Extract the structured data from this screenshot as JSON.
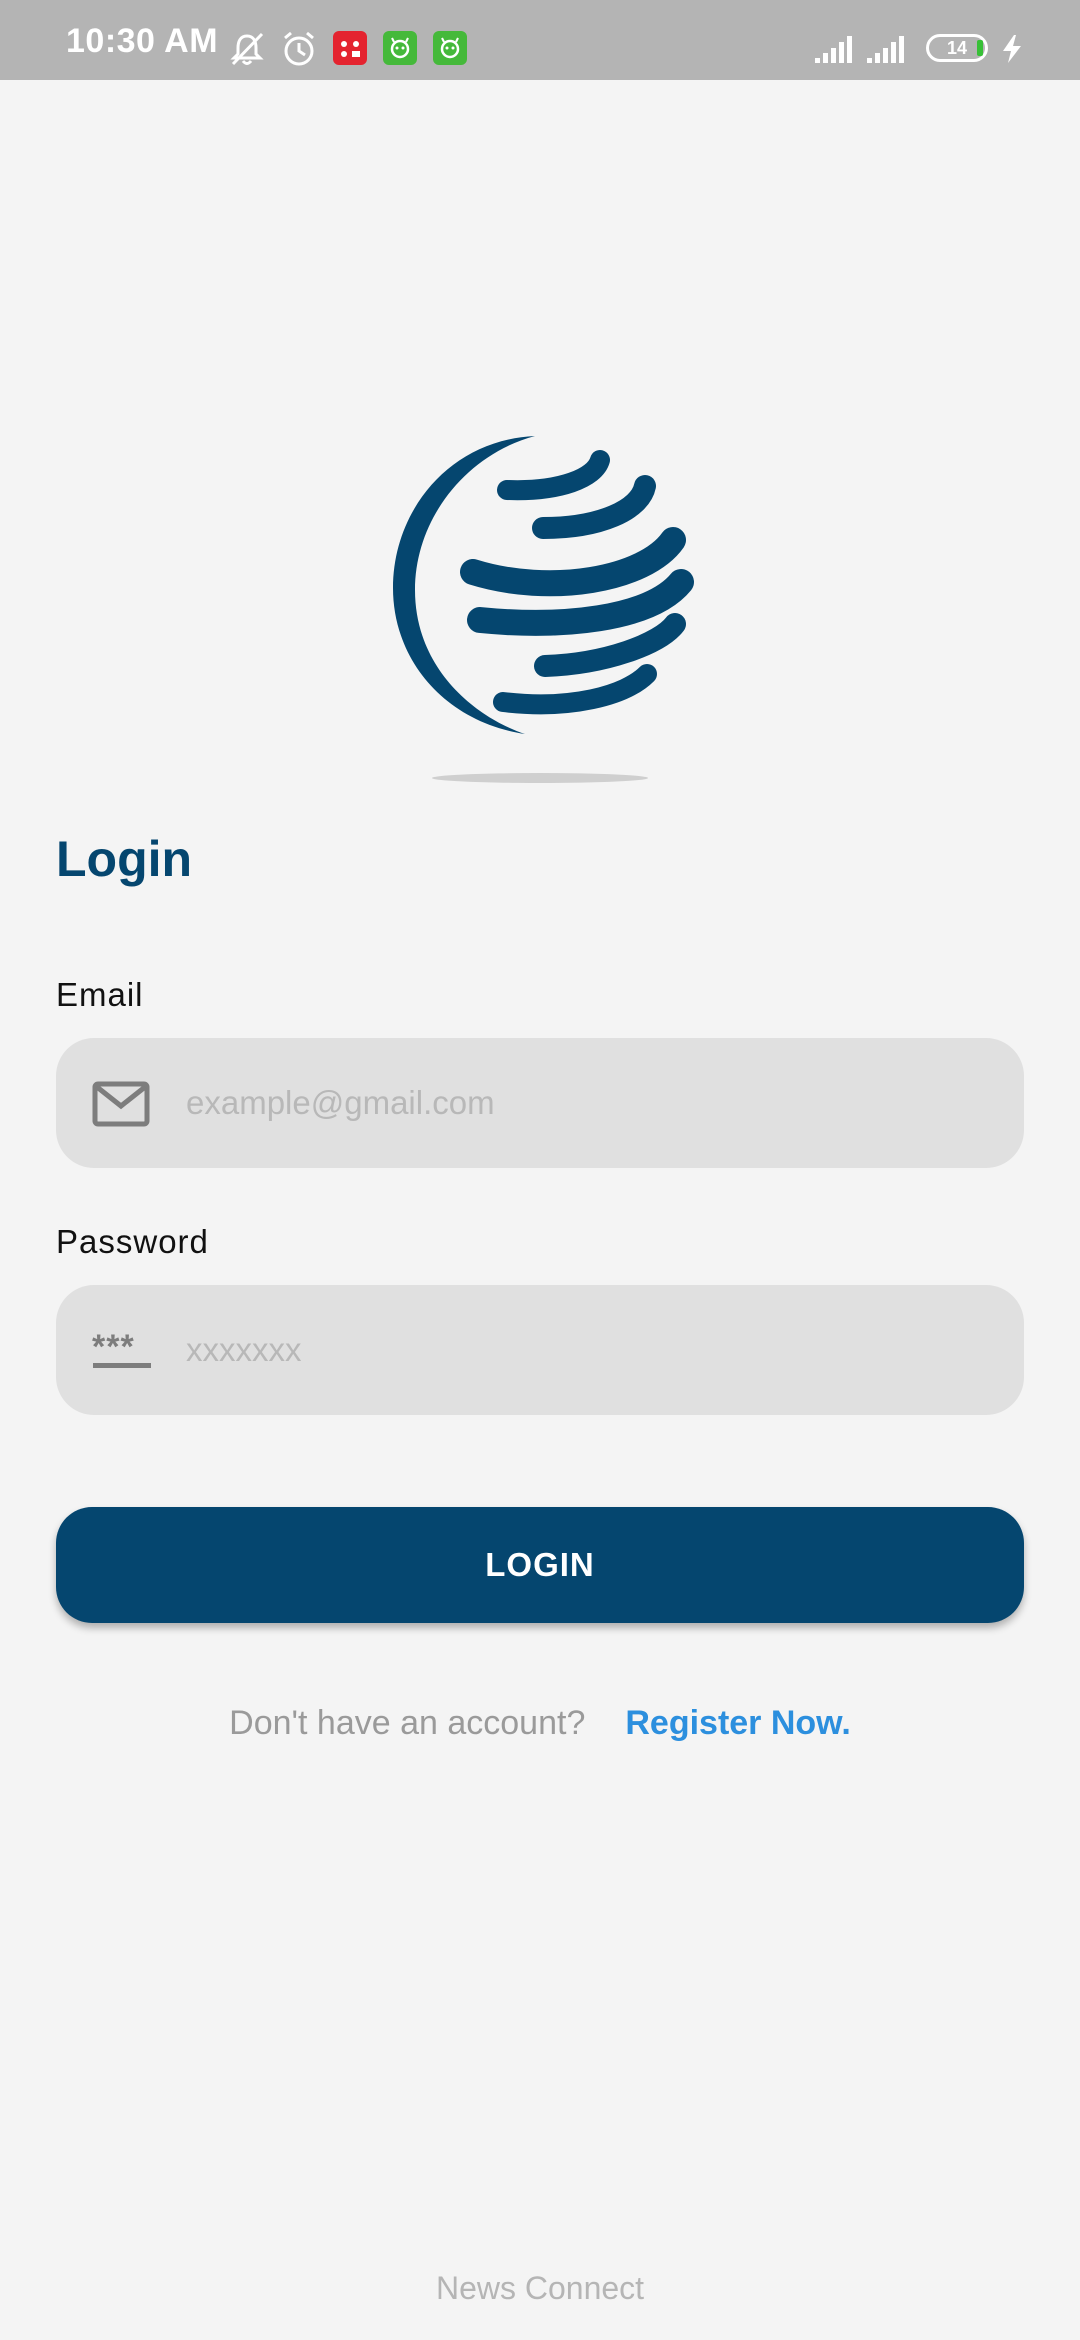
{
  "status_bar": {
    "time": "10:30 AM",
    "battery_level": "14",
    "icons": [
      "mute-icon",
      "alarm-icon",
      "notification-app-icon",
      "notification-app-icon",
      "notification-app-icon",
      "signal-icon",
      "signal-icon",
      "battery-icon",
      "charging-icon"
    ]
  },
  "login": {
    "title": "Login",
    "email": {
      "label": "Email",
      "value": "",
      "placeholder": "example@gmail.com",
      "icon": "mail-icon"
    },
    "password": {
      "label": "Password",
      "value": "",
      "placeholder": "xxxxxxx",
      "icon": "password-icon"
    },
    "button_label": "LOGIN",
    "register_prompt": "Don't have an account?",
    "register_link": "Register Now."
  },
  "footer": {
    "brand": "News Connect"
  },
  "colors": {
    "primary": "#05466f",
    "link": "#2c8fde",
    "background": "#f4f4f4",
    "field": "#e0e0e0"
  }
}
